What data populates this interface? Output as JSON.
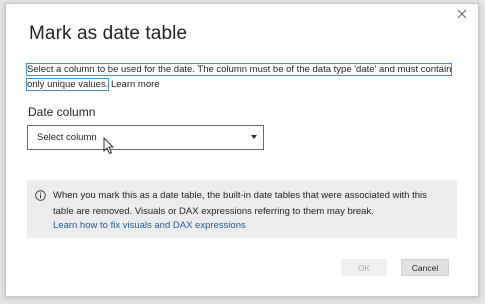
{
  "dialog": {
    "title": "Mark as date table",
    "description": "Select a column to be used for the date. The column must be of the data type 'date' and must contain only unique values.",
    "learn_more": "Learn more",
    "field_label": "Date column",
    "select_value": "Select column",
    "info_text": "When you mark this as a date table, the built-in date tables that were associated with this table are removed. Visuals or DAX expressions referring to them may break.",
    "info_link": "Learn how to fix visuals and DAX expressions",
    "ok_label": "OK",
    "cancel_label": "Cancel"
  },
  "icons": {
    "close": "close-icon",
    "info": "info-icon",
    "dropdown": "chevron-down-icon",
    "cursor": "mouse-pointer-icon"
  },
  "colors": {
    "link": "#1f5a9a",
    "highlight_outline": "#4a90c8",
    "info_background": "#ececec",
    "disabled_text": "#a9a9a9"
  }
}
